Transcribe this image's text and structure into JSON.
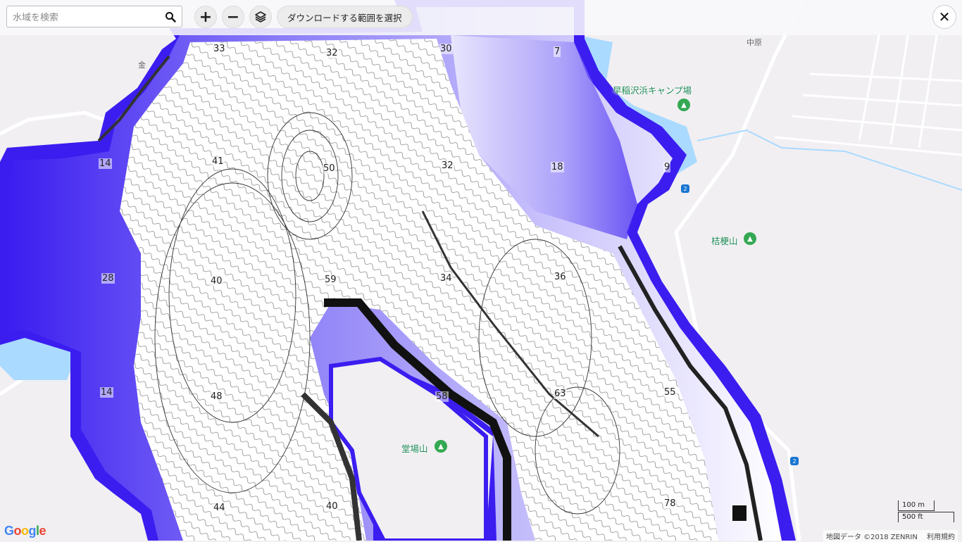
{
  "toolbar": {
    "search_placeholder": "水域を検索",
    "zoom_in_label": "+",
    "zoom_out_label": "−",
    "download_label": "ダウンロードする範囲を選択",
    "close_label": "✕"
  },
  "map": {
    "places": [
      {
        "name": "早稲沢浜キャンプ場"
      },
      {
        "name": "桔梗山"
      },
      {
        "name": "堂場山"
      },
      {
        "name": "中原"
      }
    ],
    "partial_label": "金",
    "route_number": "2",
    "depth_labels": [
      "33",
      "32",
      "30",
      "7",
      "14",
      "41",
      "50",
      "32",
      "18",
      "9",
      "28",
      "40",
      "59",
      "34",
      "36",
      "14",
      "48",
      "63",
      "55",
      "44",
      "40",
      "78",
      "58"
    ],
    "scale": {
      "metric": "100 m",
      "imperial": "500 ft"
    },
    "attribution": "地図データ ©2018 ZENRIN",
    "terms": "利用規約"
  },
  "colors": {
    "water_overlay": "#3b1df0",
    "lake_water": "#aadaff",
    "poi_green": "#34a853"
  }
}
